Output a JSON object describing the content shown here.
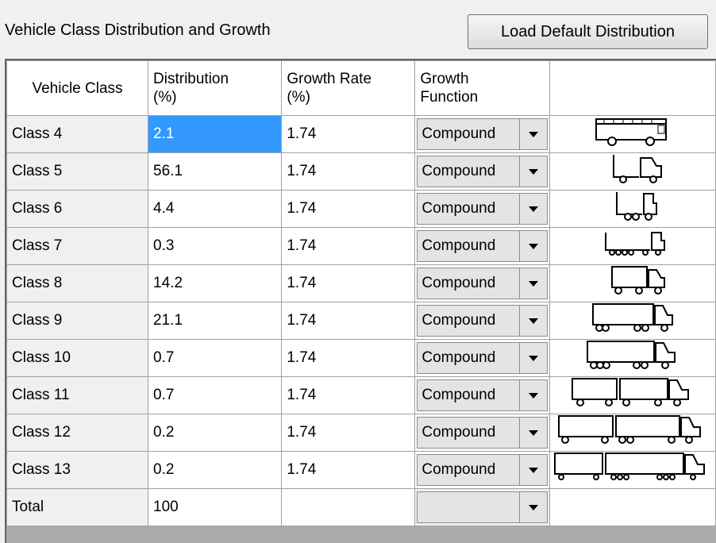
{
  "panel": {
    "title": "Vehicle Class Distribution and Growth",
    "load_button_label": "Load Default Distribution"
  },
  "columns": {
    "vehicle_class": "Vehicle Class",
    "distribution": "Distribution\n(%)",
    "growth_rate": "Growth Rate\n(%)",
    "growth_function": "Growth\nFunction"
  },
  "rows": [
    {
      "vehicle_class": "Class 4",
      "distribution": "2.1",
      "growth_rate": "1.74",
      "growth_function": "Compound",
      "icon": "bus-icon"
    },
    {
      "vehicle_class": "Class 5",
      "distribution": "56.1",
      "growth_rate": "1.74",
      "growth_function": "Compound",
      "icon": "truck-2axle-icon"
    },
    {
      "vehicle_class": "Class 6",
      "distribution": "4.4",
      "growth_rate": "1.74",
      "growth_function": "Compound",
      "icon": "truck-3axle-icon"
    },
    {
      "vehicle_class": "Class 7",
      "distribution": "0.3",
      "growth_rate": "1.74",
      "growth_function": "Compound",
      "icon": "truck-4axle-icon"
    },
    {
      "vehicle_class": "Class 8",
      "distribution": "14.2",
      "growth_rate": "1.74",
      "growth_function": "Compound",
      "icon": "tractor-trailer-icon"
    },
    {
      "vehicle_class": "Class 9",
      "distribution": "21.1",
      "growth_rate": "1.74",
      "growth_function": "Compound",
      "icon": "tractor-5axle-icon"
    },
    {
      "vehicle_class": "Class 10",
      "distribution": "0.7",
      "growth_rate": "1.74",
      "growth_function": "Compound",
      "icon": "tractor-6axle-icon"
    },
    {
      "vehicle_class": "Class 11",
      "distribution": "0.7",
      "growth_rate": "1.74",
      "growth_function": "Compound",
      "icon": "double-trailer-icon"
    },
    {
      "vehicle_class": "Class 12",
      "distribution": "0.2",
      "growth_rate": "1.74",
      "growth_function": "Compound",
      "icon": "double-trailer-6axle-icon"
    },
    {
      "vehicle_class": "Class 13",
      "distribution": "0.2",
      "growth_rate": "1.74",
      "growth_function": "Compound",
      "icon": "multi-trailer-icon"
    }
  ],
  "total": {
    "label": "Total",
    "distribution": "100",
    "growth_rate": "",
    "growth_function": ""
  },
  "selection": {
    "row": 0,
    "column": "distribution",
    "color": "#3399ff"
  }
}
